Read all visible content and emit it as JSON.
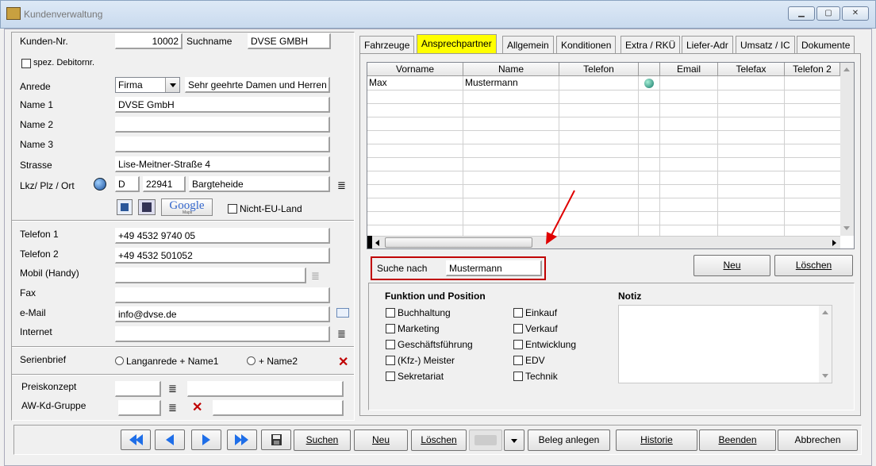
{
  "window": {
    "title": "Kundenverwaltung",
    "minimize": "▁",
    "maximize": "▢",
    "close": "✕"
  },
  "left": {
    "kunden_nr_label": "Kunden-Nr.",
    "kunden_nr": "10002",
    "suchname_label": "Suchname",
    "suchname": "DVSE GMBH",
    "spez_label": "spez. Debitornr.",
    "anrede_label": "Anrede",
    "anrede_value": "Firma",
    "briefanrede": "Sehr geehrte Damen und Herren",
    "name1_label": "Name 1",
    "name1": "DVSE GmbH",
    "name2_label": "Name 2",
    "name2": "",
    "name3_label": "Name 3",
    "name3": "",
    "strasse_label": "Strasse",
    "strasse": "Lise-Meitner-Straße 4",
    "lkz_label": "Lkz/ Plz / Ort",
    "lkz": "D",
    "plz": "22941",
    "ort": "Bargteheide",
    "google_label": "Google",
    "google_sub": "Maps",
    "nicht_eu_label": "Nicht-EU-Land",
    "telefon1_label": "Telefon 1",
    "telefon1": "+49 4532 9740 05",
    "telefon2_label": "Telefon 2",
    "telefon2": "+49 4532 501052",
    "mobil_label": "Mobil (Handy)",
    "mobil": "",
    "fax_label": "Fax",
    "fax": "",
    "email_label": "e-Mail",
    "email": "info@dvse.de",
    "internet_label": "Internet",
    "internet": "",
    "serienbrief_label": "Serienbrief",
    "serien_opt1": "Langanrede + Name1",
    "serien_opt2": "+ Name2",
    "preiskonzept_label": "Preiskonzept",
    "awkd_label": "AW-Kd-Gruppe"
  },
  "tabs": [
    "Fahrzeuge",
    "Ansprechpartner",
    "Allgemein",
    "Konditionen",
    "Extra / RKÜ",
    "Liefer-Adr",
    "Umsatz / IC",
    "Dokumente"
  ],
  "active_tab": 1,
  "grid": {
    "columns": [
      "Vorname",
      "Name",
      "Telefon",
      "",
      "Email",
      "Telefax",
      "Telefon 2"
    ],
    "rows": [
      {
        "vorname": "Max",
        "name": "Mustermann",
        "telefon": "",
        "email": "",
        "telefax": "",
        "telefon2": ""
      }
    ]
  },
  "search": {
    "label": "Suche nach",
    "value": "Mustermann"
  },
  "contact_buttons": {
    "neu": "Neu",
    "loeschen": "Löschen"
  },
  "funktion": {
    "title": "Funktion und Position",
    "col1": [
      "Buchhaltung",
      "Marketing",
      "Geschäftsführung",
      "(Kfz-) Meister",
      "Sekretariat"
    ],
    "col2": [
      "Einkauf",
      "Verkauf",
      "Entwicklung",
      "EDV",
      "Technik"
    ],
    "notiz_label": "Notiz"
  },
  "toolbar": {
    "suchen": "Suchen",
    "neu": "Neu",
    "loeschen": "Löschen",
    "beleg": "Beleg anlegen",
    "historie": "Historie",
    "beenden": "Beenden",
    "abbrechen": "Abbrechen"
  },
  "colors": {
    "active_tab": "#ffff00",
    "highlight_box": "#c00000",
    "arrow": "#e00000",
    "nav_arrow": "#1e6ee8"
  }
}
